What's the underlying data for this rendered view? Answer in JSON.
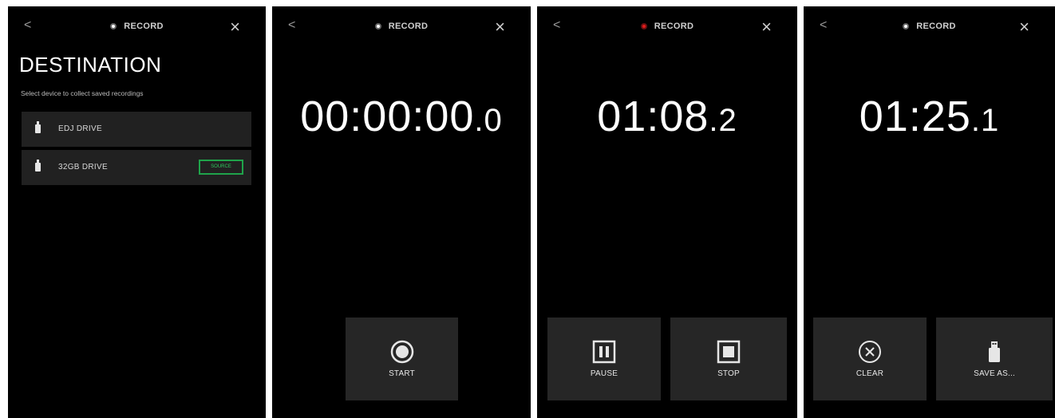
{
  "common": {
    "back_glyph": "<",
    "title": "RECORD",
    "close_glyph": "×"
  },
  "destination": {
    "heading": "DESTINATION",
    "subtitle": "Select device to collect saved recordings",
    "drives": [
      {
        "label": "EDJ DRIVE"
      },
      {
        "label": "32GB DRIVE",
        "badge": "SOURCE"
      }
    ]
  },
  "screens": [
    {
      "time_main": "00:00:00",
      "time_tenth": ".0",
      "recording": false,
      "buttons": [
        {
          "label": "START",
          "icon": "record-icon"
        }
      ]
    },
    {
      "time_main": "01:08",
      "time_tenth": ".2",
      "recording": true,
      "buttons": [
        {
          "label": "PAUSE",
          "icon": "pause-icon"
        },
        {
          "label": "STOP",
          "icon": "stop-icon"
        }
      ]
    },
    {
      "time_main": "01:25",
      "time_tenth": ".1",
      "recording": false,
      "buttons": [
        {
          "label": "CLEAR",
          "icon": "clear-icon"
        },
        {
          "label": "SAVE AS...",
          "icon": "usb-drive-icon"
        }
      ]
    }
  ],
  "colors": {
    "background": "#000000",
    "button_bg": "#262626",
    "row_bg": "#212121",
    "accent_green": "#1fa34a",
    "record_red": "#e11b1b"
  }
}
